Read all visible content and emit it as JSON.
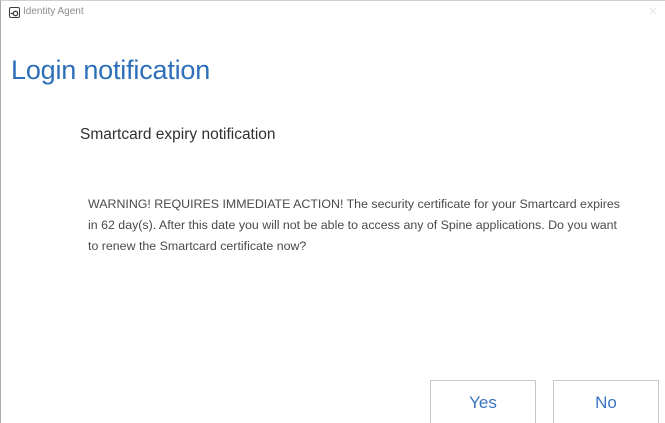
{
  "window": {
    "app_title": "Identity Agent",
    "close_glyph": "✕",
    "icon": "identity-agent-icon"
  },
  "dialog": {
    "title": "Login notification",
    "subtitle": "Smartcard expiry notification",
    "message": "WARNING! REQUIRES IMMEDIATE ACTION! The security certificate for your Smartcard expires in   62 day(s). After this date you will not be able to access any of Spine applications. Do you want to renew the Smartcard certificate now?"
  },
  "buttons": {
    "yes_label": "Yes",
    "no_label": "No"
  },
  "colors": {
    "accent": "#2e6fb9",
    "button_text": "#3a74c0",
    "body_text": "#4a4a4a"
  }
}
